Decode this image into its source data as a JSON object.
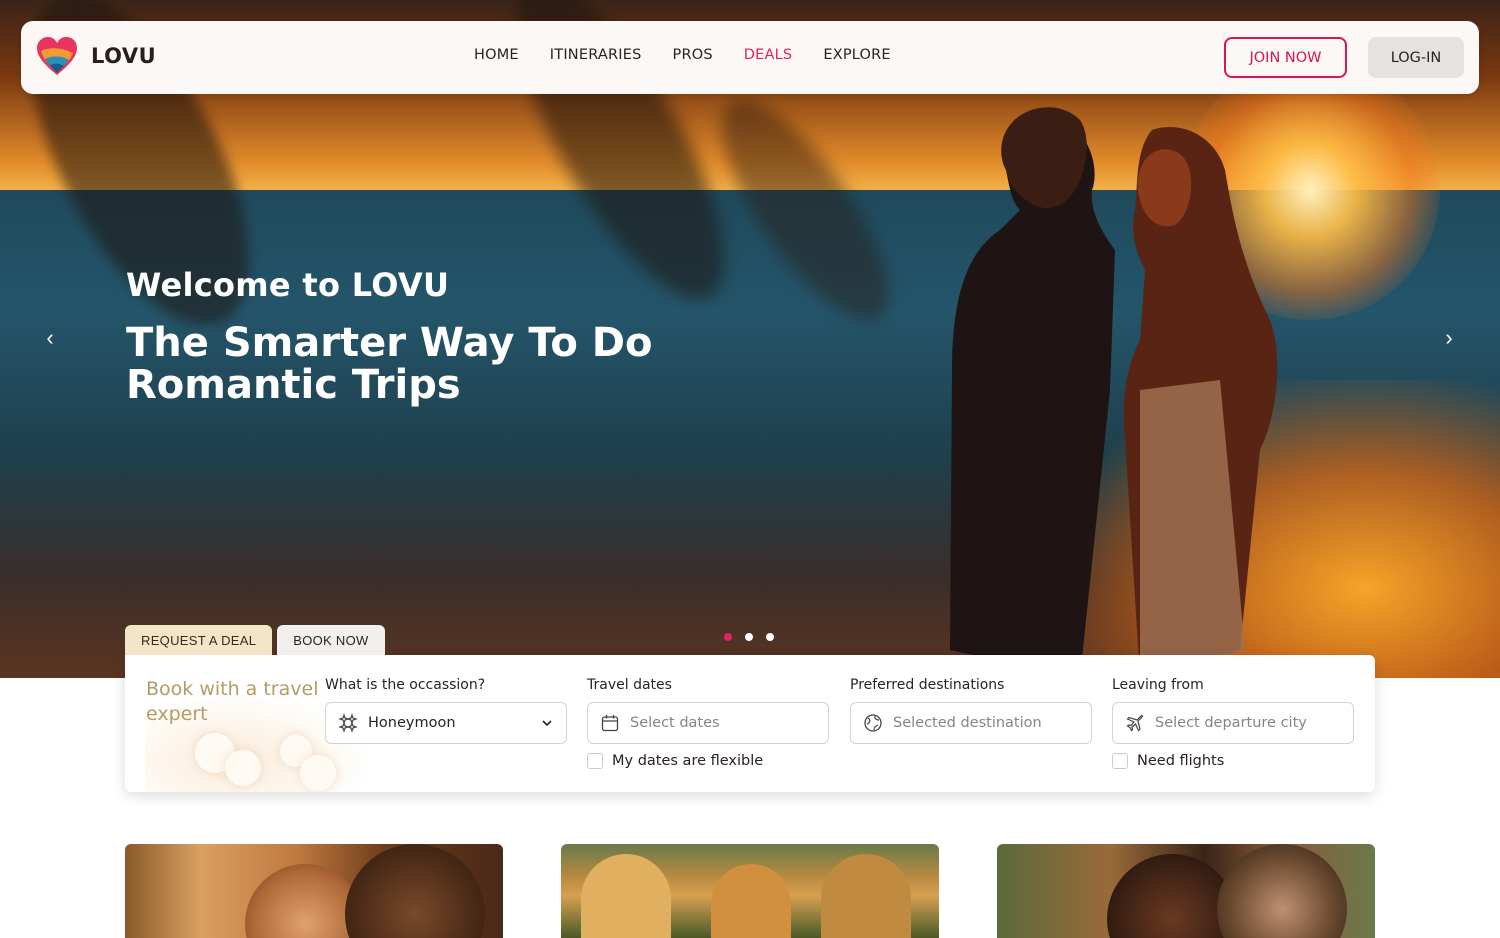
{
  "nav": {
    "logo_text": "LOVU",
    "links": [
      {
        "label": "HOME",
        "active": false
      },
      {
        "label": "ITINERARIES",
        "active": false
      },
      {
        "label": "PROS",
        "active": false
      },
      {
        "label": "DEALS",
        "active": true
      },
      {
        "label": "EXPLORE",
        "active": false
      }
    ],
    "join_label": "JOIN NOW",
    "login_label": "LOG-IN"
  },
  "hero": {
    "welcome": "Welcome to LOVU",
    "headline": "The Smarter Way To Do Romantic Trips",
    "prev_icon": "chevron-left-icon",
    "next_icon": "chevron-right-icon",
    "slides_total": 3,
    "slide_active": 1
  },
  "booking": {
    "tabs": [
      {
        "label": "REQUEST A DEAL",
        "active": true
      },
      {
        "label": "BOOK NOW",
        "active": false
      }
    ],
    "brand_title": "Book with a travel expert",
    "occasion": {
      "label": "What is the occassion?",
      "value": "Honeymoon",
      "icon": "sparkle-icon"
    },
    "dates": {
      "label": "Travel dates",
      "placeholder": "Select dates",
      "icon": "calendar-icon",
      "checkbox_label": "My dates are flexible"
    },
    "destinations": {
      "label": "Preferred destinations",
      "placeholder": "Selected destination",
      "icon": "globe-icon"
    },
    "leaving": {
      "label": "Leaving from",
      "placeholder": "Select departure city",
      "icon": "plane-icon",
      "checkbox_label": "Need flights"
    }
  },
  "colors": {
    "accent": "#e0245e",
    "join_border": "#d8174f",
    "gold": "#b89a63",
    "tab_active": "#f3e6c8"
  }
}
